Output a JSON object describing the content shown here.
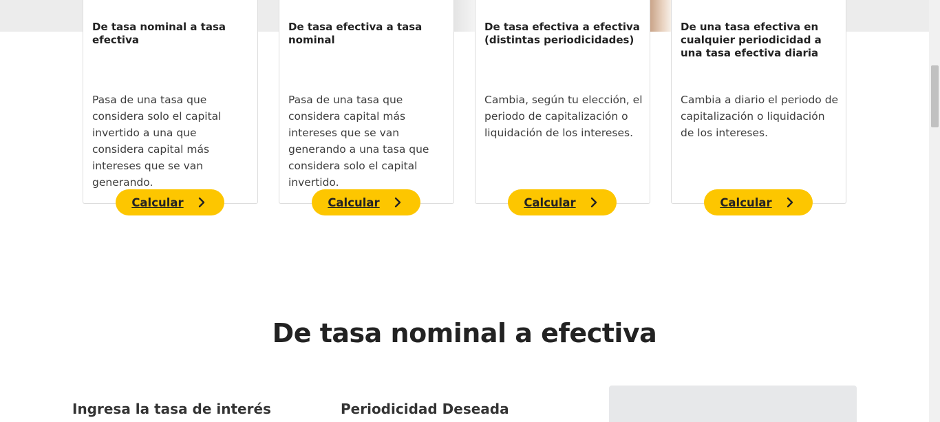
{
  "cards": [
    {
      "title": "De tasa nominal a tasa efectiva",
      "description": "Pasa de una tasa que considera solo el capital invertido a una que considera capital más intereses que se van generando.",
      "button": "Calcular"
    },
    {
      "title": "De tasa efectiva a tasa nominal",
      "description": "Pasa de una tasa que considera capital más intereses que se van generando a una tasa que considera solo el capital invertido.",
      "button": "Calcular"
    },
    {
      "title": "De tasa efectiva a efectiva (distintas periodicidades)",
      "description": "Cambia, según tu elección, el periodo de capitalización o liquidación de los intereses.",
      "button": "Calcular"
    },
    {
      "title": "De una tasa efectiva en cualquier periodicidad a una tasa efectiva diaria",
      "description": "Cambia a diario el periodo de capitalización o liquidación de los intereses.",
      "button": "Calcular"
    }
  ],
  "section": {
    "title": "De tasa nominal a efectiva",
    "rate_label": "Ingresa la tasa de interés",
    "period_label": "Periodicidad Deseada"
  },
  "colors": {
    "accent": "#fdc600",
    "panel": "#e7e8ea"
  },
  "icons": {
    "button_icon": "chevron-right-icon"
  }
}
